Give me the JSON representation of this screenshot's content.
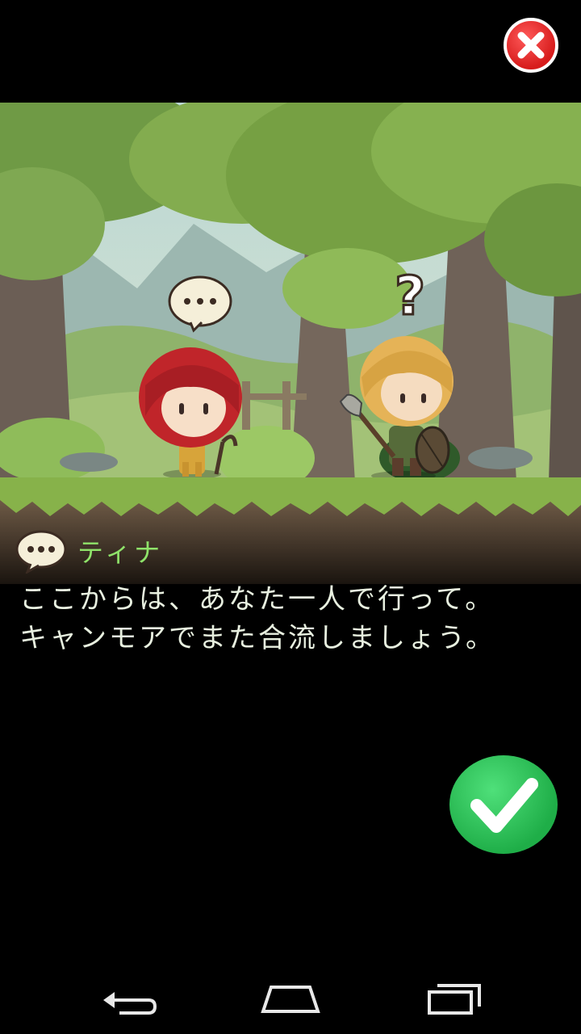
{
  "dialog": {
    "speaker": "ティナ",
    "lines": [
      "ここからは、あなた一人で行って。",
      "キャンモアでまた合流しましょう。"
    ]
  },
  "scene": {
    "girl_bubble": "…",
    "boy_bubble": "?"
  },
  "icons": {
    "close": "close-x-icon",
    "confirm": "checkmark-icon",
    "speech": "speech-bubble-icon",
    "nav_back": "back-arrow-icon",
    "nav_home": "home-icon",
    "nav_recents": "recents-icon"
  },
  "colors": {
    "speaker_name": "#8fe36a",
    "dialogue_text": "#e8f0e0",
    "close_button": "#e02525",
    "confirm_button": "#2cc55a",
    "background": "#000000"
  }
}
